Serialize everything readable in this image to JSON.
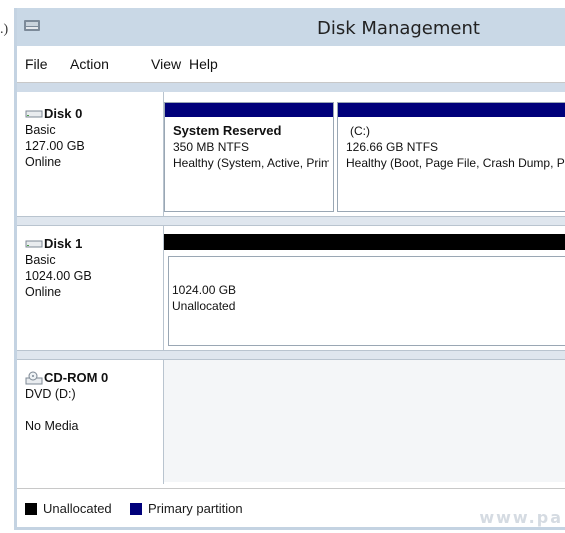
{
  "cut_label": ".)",
  "window": {
    "title": "Disk Management",
    "icon": "disk-management-icon"
  },
  "menu": {
    "file": "File",
    "action": "Action",
    "view": "View",
    "help": "Help"
  },
  "disks": [
    {
      "name": "Disk 0",
      "type": "Basic",
      "size": "127.00 GB",
      "status": "Online",
      "icon": "hard-disk-icon",
      "partitions": [
        {
          "name": "System Reserved",
          "size_fs": "350 MB NTFS",
          "status": "Healthy (System, Active, Primary Partition)",
          "kind": "primary"
        },
        {
          "name": "(C:)",
          "size_fs": "126.66 GB NTFS",
          "status": "Healthy (Boot, Page File, Crash Dump, Primary Partition)",
          "kind": "primary"
        }
      ]
    },
    {
      "name": "Disk 1",
      "type": "Basic",
      "size": "1024.00 GB",
      "status": "Online",
      "icon": "hard-disk-icon",
      "partitions": [
        {
          "size": "1024.00 GB",
          "status": "Unallocated",
          "kind": "unallocated"
        }
      ]
    },
    {
      "name": "CD-ROM 0",
      "type": "DVD (D:)",
      "status": "No Media",
      "icon": "cd-rom-icon"
    }
  ],
  "legend": {
    "unallocated": "Unallocated",
    "primary": "Primary partition"
  },
  "colors": {
    "primary": "#00007a",
    "unallocated": "#000000",
    "title_bar": "#c9d8e6"
  },
  "watermark": "www.pa"
}
